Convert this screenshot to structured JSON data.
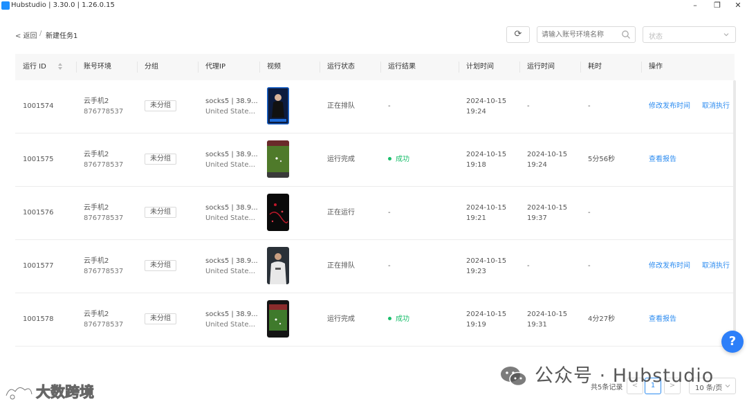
{
  "window": {
    "title": "Hubstudio | 3.30.0 | 1.26.0.15",
    "min_glyph": "–",
    "max_glyph": "❐",
    "close_glyph": "✕"
  },
  "breadcrumb": {
    "back": "< 返回",
    "separator": "/",
    "current": "新建任务1"
  },
  "toolbar": {
    "refresh_glyph": "⟳",
    "search_placeholder": "请输入账号环境名称",
    "status_placeholder": "状态"
  },
  "table": {
    "columns": [
      "运行 ID",
      "账号环境",
      "分组",
      "代理IP",
      "视频",
      "运行状态",
      "运行结果",
      "计划时间",
      "运行时间",
      "耗时",
      "操作"
    ],
    "rows": [
      {
        "id": "1001574",
        "account_name": "云手机2",
        "account_id": "876778537",
        "group": "未分组",
        "proxy_line1": "socks5 | 38.9...",
        "proxy_line2": "United State...",
        "status": "正在排队",
        "result": "-",
        "plan_date": "2024-10-15",
        "plan_time": "19:24",
        "run_date": "-",
        "run_time": "",
        "duration": "-",
        "op1": "修改发布时间",
        "op2": "取消执行"
      },
      {
        "id": "1001575",
        "account_name": "云手机2",
        "account_id": "876778537",
        "group": "未分组",
        "proxy_line1": "socks5 | 38.9...",
        "proxy_line2": "United State...",
        "status": "运行完成",
        "result": "成功",
        "plan_date": "2024-10-15",
        "plan_time": "19:18",
        "run_date": "2024-10-15",
        "run_time": "19:24",
        "duration": "5分56秒",
        "op1": "查看报告",
        "op2": ""
      },
      {
        "id": "1001576",
        "account_name": "云手机2",
        "account_id": "876778537",
        "group": "未分组",
        "proxy_line1": "socks5 | 38.9...",
        "proxy_line2": "United State...",
        "status": "正在运行",
        "result": "-",
        "plan_date": "2024-10-15",
        "plan_time": "19:21",
        "run_date": "2024-10-15",
        "run_time": "19:37",
        "duration": "-",
        "op1": "",
        "op2": ""
      },
      {
        "id": "1001577",
        "account_name": "云手机2",
        "account_id": "876778537",
        "group": "未分组",
        "proxy_line1": "socks5 | 38.9...",
        "proxy_line2": "United State...",
        "status": "正在排队",
        "result": "-",
        "plan_date": "2024-10-15",
        "plan_time": "19:23",
        "run_date": "-",
        "run_time": "",
        "duration": "-",
        "op1": "修改发布时间",
        "op2": "取消执行"
      },
      {
        "id": "1001578",
        "account_name": "云手机2",
        "account_id": "876778537",
        "group": "未分组",
        "proxy_line1": "socks5 | 38.9...",
        "proxy_line2": "United State...",
        "status": "运行完成",
        "result": "成功",
        "plan_date": "2024-10-15",
        "plan_time": "19:19",
        "run_date": "2024-10-15",
        "run_time": "19:31",
        "duration": "4分27秒",
        "op1": "查看报告",
        "op2": ""
      }
    ]
  },
  "help": {
    "glyph": "?"
  },
  "pagination": {
    "total": "共5条记录",
    "prev_glyph": "<",
    "current_page": "1",
    "next_glyph": ">",
    "page_size": "10 条/页"
  },
  "watermarks": {
    "wechat": "公众号 · Hubstudio",
    "dsk": "大数跨境"
  },
  "colors": {
    "link": "#2d8cf0",
    "success": "#19be6b",
    "help_button": "#2d7ff9"
  }
}
